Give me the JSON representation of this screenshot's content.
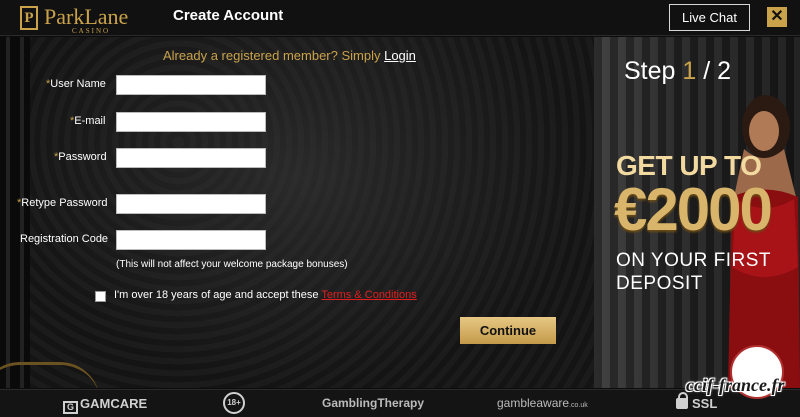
{
  "header": {
    "logo_name": "ParkLane",
    "logo_sub": "CASINO",
    "logo_mark": "P",
    "title": "Create Account",
    "live_chat_label": "Live Chat",
    "close_symbol": "✕"
  },
  "form": {
    "already_text": "Already a registered member? Simply ",
    "login_label": "Login",
    "required_marker": "*",
    "fields": [
      {
        "label": "User Name",
        "required": true,
        "value": ""
      },
      {
        "label": "E-mail",
        "required": true,
        "value": ""
      },
      {
        "label": "Password",
        "required": true,
        "value": ""
      },
      {
        "label": "Retype Password",
        "required": true,
        "value": ""
      },
      {
        "label": "Registration Code",
        "required": false,
        "value": ""
      }
    ],
    "registration_note": "(This will not affect your welcome package bonuses)",
    "age_text": "I'm over 18 years of age and accept these ",
    "terms_label": "Terms & Conditions",
    "age_checked": false,
    "continue_label": "Continue"
  },
  "promo": {
    "step_label": "Step",
    "step_current": "1",
    "step_separator": "/",
    "step_total": "2",
    "line1": "GET UP TO",
    "amount": "€2000",
    "line2": "ON YOUR FIRST",
    "line3": "DEPOSIT"
  },
  "footer": {
    "gamcare": "GAMCARE",
    "age_badge": "18+",
    "gambling_therapy": "GamblingTherapy",
    "gamble_aware": "gambleaware",
    "gamble_aware_suffix": ".co.uk",
    "ssl": "SSL"
  },
  "watermark": {
    "text": "ccif-france.fr"
  },
  "colors": {
    "accent_gold": "#c9a24a",
    "link_red": "#e02020",
    "background": "#141414"
  }
}
